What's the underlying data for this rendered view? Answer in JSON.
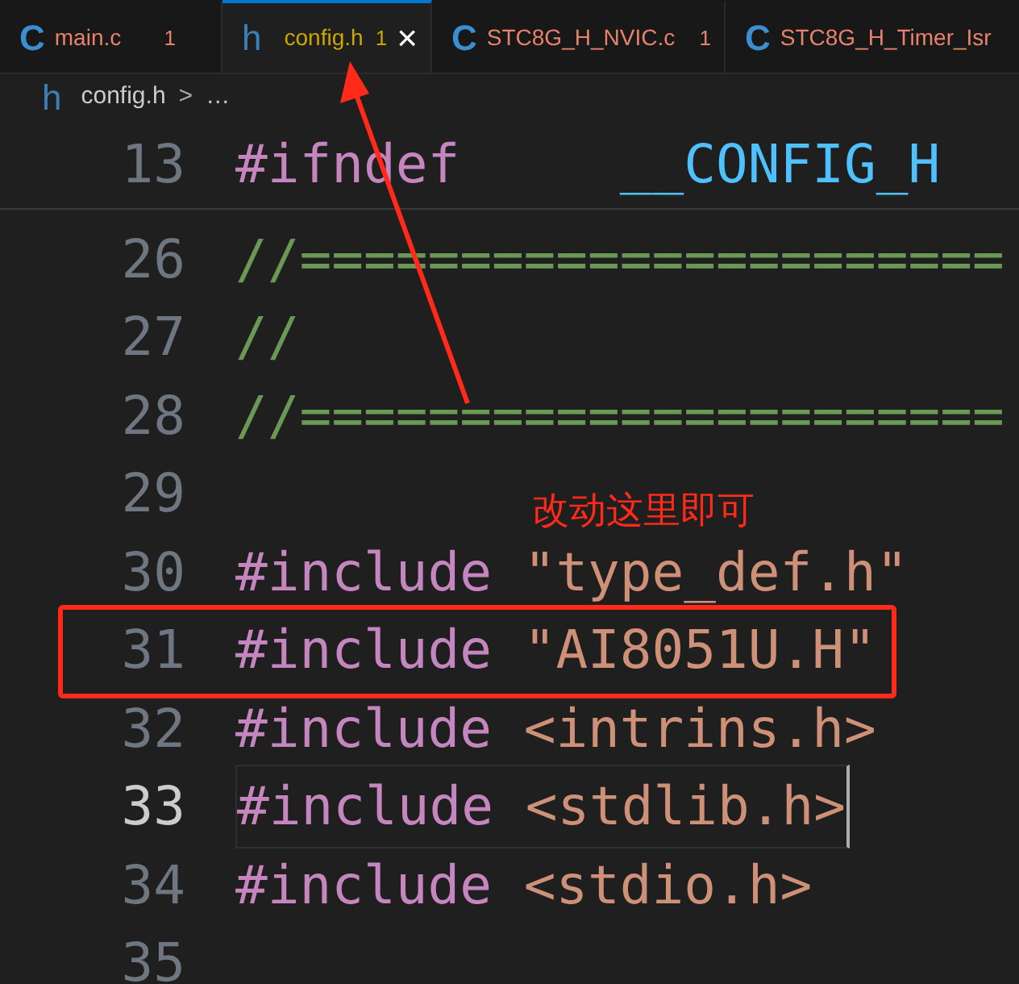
{
  "tabs": [
    {
      "icon": "C",
      "label": "main.c",
      "badge": "1",
      "selected": false,
      "color": "#e8826b"
    },
    {
      "icon": "h",
      "label": "config.h",
      "badge": "1",
      "selected": true,
      "color": "#cca700",
      "close": "×"
    },
    {
      "icon": "C",
      "label": "STC8G_H_NVIC.c",
      "badge": "1",
      "selected": false,
      "color": "#e8826b"
    },
    {
      "icon": "C",
      "label": "STC8G_H_Timer_Isr",
      "selected": false,
      "color": "#e8826b"
    }
  ],
  "breadcrumb": {
    "icon": "h",
    "file": "config.h",
    "separator": ">",
    "more": "…"
  },
  "lines": [
    {
      "number": "13",
      "tokens": [
        {
          "kind": "directive",
          "text": "#ifndef"
        },
        {
          "kind": "macro",
          "text": "     __CONFIG_H"
        }
      ],
      "folded": true
    },
    {
      "number": "26",
      "tokens": [
        {
          "kind": "comment",
          "text": "//======================"
        }
      ]
    },
    {
      "number": "27",
      "tokens": [
        {
          "kind": "comment",
          "text": "//"
        }
      ]
    },
    {
      "number": "28",
      "tokens": [
        {
          "kind": "comment",
          "text": "//======================"
        }
      ]
    },
    {
      "number": "29"
    },
    {
      "number": "30",
      "tokens": [
        {
          "kind": "directive",
          "text": "#include"
        },
        {
          "kind": "string",
          "text": " \"type_def.h\""
        }
      ]
    },
    {
      "number": "31",
      "tokens": [
        {
          "kind": "directive",
          "text": "#include"
        },
        {
          "kind": "string",
          "text": " \"AI8051U.H\""
        }
      ],
      "highlighted": true
    },
    {
      "number": "32",
      "tokens": [
        {
          "kind": "directive",
          "text": "#include"
        },
        {
          "kind": "string",
          "text": " <intrins.h>"
        }
      ]
    },
    {
      "number": "33",
      "tokens": [
        {
          "kind": "directive",
          "text": "#include"
        },
        {
          "kind": "string",
          "text": " <stdlib.h>"
        }
      ],
      "current": true
    },
    {
      "number": "34",
      "tokens": [
        {
          "kind": "directive",
          "text": "#include"
        },
        {
          "kind": "string",
          "text": " <stdio.h>"
        }
      ]
    },
    {
      "number": "35"
    }
  ],
  "annotation": {
    "text": "改动这里即可"
  }
}
